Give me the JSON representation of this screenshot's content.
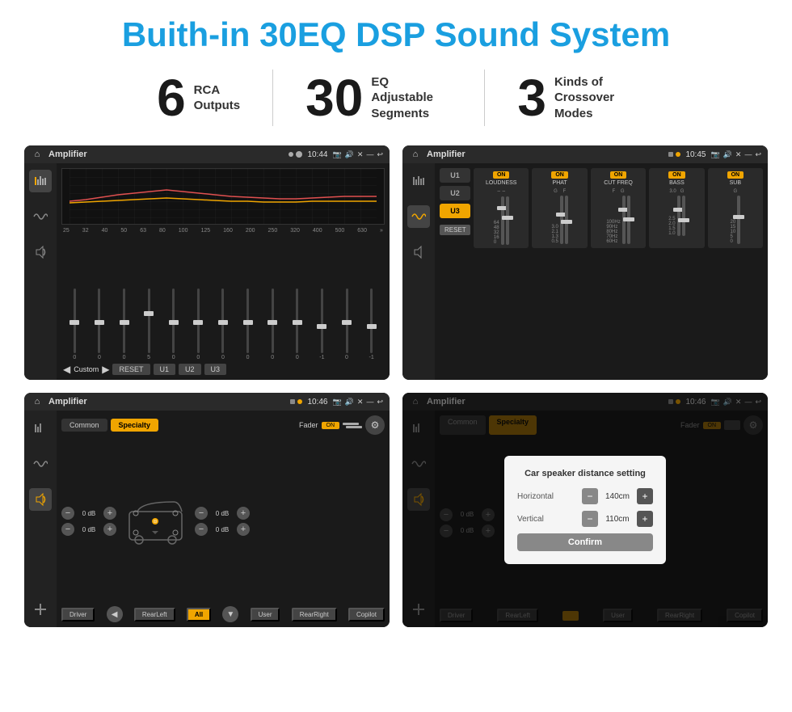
{
  "header": {
    "title": "Buith-in 30EQ DSP Sound System"
  },
  "stats": [
    {
      "number": "6",
      "text_line1": "RCA",
      "text_line2": "Outputs"
    },
    {
      "number": "30",
      "text_line1": "EQ Adjustable",
      "text_line2": "Segments"
    },
    {
      "number": "3",
      "text_line1": "Kinds of",
      "text_line2": "Crossover Modes"
    }
  ],
  "screens": [
    {
      "id": "screen1",
      "title": "Amplifier",
      "time": "10:44",
      "type": "equalizer"
    },
    {
      "id": "screen2",
      "title": "Amplifier",
      "time": "10:45",
      "type": "amplifier"
    },
    {
      "id": "screen3",
      "title": "Amplifier",
      "time": "10:46",
      "type": "crossover"
    },
    {
      "id": "screen4",
      "title": "Amplifier",
      "time": "10:46",
      "type": "dialog"
    }
  ],
  "screen1": {
    "freq_labels": [
      "25",
      "32",
      "40",
      "50",
      "63",
      "80",
      "100",
      "125",
      "160",
      "200",
      "250",
      "320",
      "400",
      "500",
      "630"
    ],
    "slider_values": [
      "0",
      "0",
      "0",
      "5",
      "0",
      "0",
      "0",
      "0",
      "0",
      "0",
      "-1",
      "0",
      "-1"
    ],
    "buttons": [
      "Custom",
      "RESET",
      "U1",
      "U2",
      "U3"
    ]
  },
  "screen2": {
    "presets": [
      "U1",
      "U2",
      "U3"
    ],
    "modules": [
      {
        "label": "LOUDNESS",
        "on": true
      },
      {
        "label": "PHAT",
        "on": true
      },
      {
        "label": "CUT FREQ",
        "on": true
      },
      {
        "label": "BASS",
        "on": true
      },
      {
        "label": "SUB",
        "on": true
      }
    ],
    "reset_label": "RESET"
  },
  "screen3": {
    "tabs": [
      "Common",
      "Specialty"
    ],
    "fader_label": "Fader",
    "fader_on": "ON",
    "db_values": [
      "0 dB",
      "0 dB",
      "0 dB",
      "0 dB"
    ],
    "bottom_buttons": [
      "Driver",
      "RearLeft",
      "All",
      "User",
      "RearRight",
      "Copilot"
    ]
  },
  "screen4": {
    "tabs": [
      "Common",
      "Specialty"
    ],
    "dialog": {
      "title": "Car speaker distance setting",
      "horizontal_label": "Horizontal",
      "horizontal_value": "140cm",
      "vertical_label": "Vertical",
      "vertical_value": "110cm",
      "confirm_label": "Confirm"
    },
    "db_values": [
      "0 dB",
      "0 dB"
    ],
    "bottom_buttons": [
      "Driver",
      "RearLeft",
      "All",
      "User",
      "RearRight",
      "Copilot"
    ]
  }
}
